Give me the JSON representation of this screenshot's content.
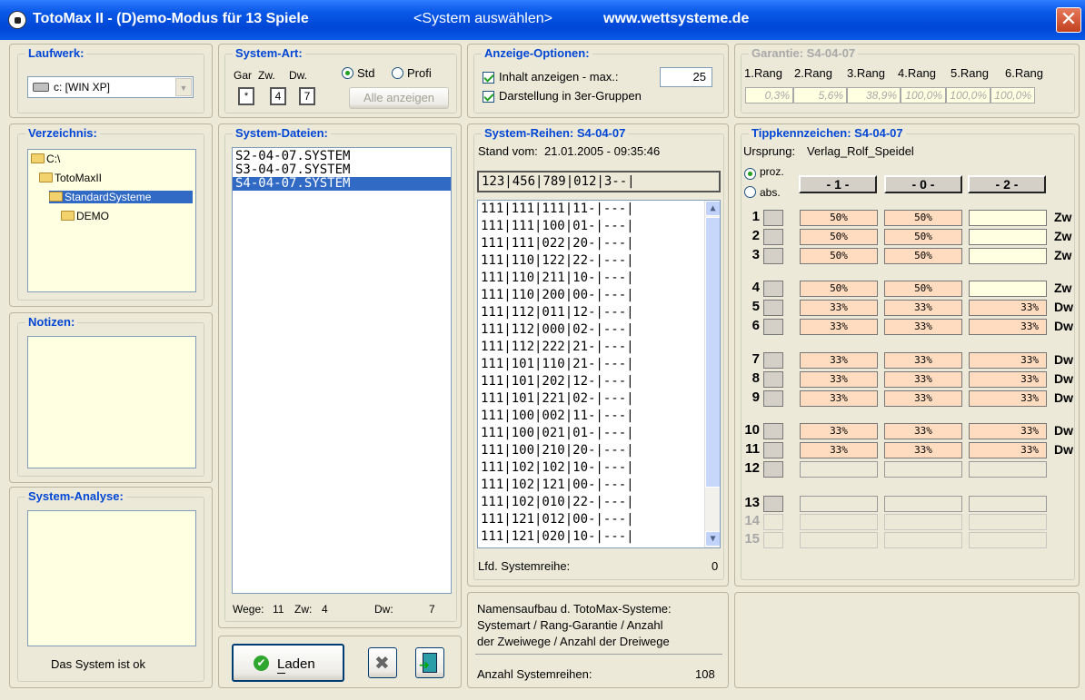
{
  "title": {
    "app": "TotoMax II - (D)emo-Modus für 13 Spiele",
    "context": "<System auswählen>",
    "url": "www.wettsysteme.de",
    "close": "✕"
  },
  "laufwerk": {
    "legend": "Laufwerk:",
    "selected": "c: [WIN XP]"
  },
  "verzeichnis": {
    "legend": "Verzeichnis:",
    "items": [
      "C:\\",
      "TotoMaxII",
      "StandardSysteme",
      "DEMO"
    ]
  },
  "notizen": {
    "legend": "Notizen:"
  },
  "analyse": {
    "legend": "System-Analyse:",
    "status": "Das System ist ok"
  },
  "system_art": {
    "legend": "System-Art:",
    "col_gar": "Gar",
    "col_zw": "Zw.",
    "col_dw": "Dw.",
    "val_gar": "*",
    "val_zw": "4",
    "val_dw": "7",
    "opt_std": "Std",
    "opt_profi": "Profi",
    "alle_btn": "Alle anzeigen"
  },
  "system_dateien": {
    "legend": "System-Dateien:",
    "files": [
      "S2-04-07.SYSTEM",
      "S3-04-07.SYSTEM",
      "S4-04-07.SYSTEM"
    ],
    "wege_label": "Wege:",
    "wege": "11",
    "zw_label": "Zw:",
    "zw": "4",
    "dw_label": "Dw:",
    "dw": "7"
  },
  "actions": {
    "laden": "Laden"
  },
  "anzeige": {
    "legend": "Anzeige-Optionen:",
    "inhalt": "Inhalt anzeigen - max.:",
    "max": "25",
    "gruppen": "Darstellung in 3er-Gruppen"
  },
  "system_reihen": {
    "legend": "System-Reihen: S4-04-07",
    "stand_label": "Stand vom:",
    "stand": "21.01.2005  -  09:35:46",
    "header": "123|456|789|012|3--|",
    "rows": [
      "111|111|111|11-|---|",
      "111|111|100|01-|---|",
      "111|111|022|20-|---|",
      "111|110|122|22-|---|",
      "111|110|211|10-|---|",
      "111|110|200|00-|---|",
      "111|112|011|12-|---|",
      "111|112|000|02-|---|",
      "111|112|222|21-|---|",
      "111|101|110|21-|---|",
      "111|101|202|12-|---|",
      "111|101|221|02-|---|",
      "111|100|002|11-|---|",
      "111|100|021|01-|---|",
      "111|100|210|20-|---|",
      "111|102|102|10-|---|",
      "111|102|121|00-|---|",
      "111|102|010|22-|---|",
      "111|121|012|00-|---|",
      "111|121|020|10-|---|"
    ],
    "lfd_label": "Lfd. Systemreihe:",
    "lfd": "0"
  },
  "info": {
    "line1": "Namensaufbau d. TotoMax-Systeme:",
    "line2": "Systemart / Rang-Garantie / Anzahl",
    "line3": "der Zweiwege / Anzahl der Dreiwege",
    "anzahl_label": "Anzahl Systemreihen:",
    "anzahl": "108"
  },
  "garantie": {
    "legend": "Garantie: S4-04-07",
    "ranks": [
      "1.Rang",
      "2.Rang",
      "3.Rang",
      "4.Rang",
      "5.Rang",
      "6.Rang"
    ],
    "values": [
      "0,3%",
      "5,6%",
      "38,9%",
      "100,0%",
      "100,0%",
      "100,0%"
    ]
  },
  "tipp": {
    "legend": "Tippkennzeichen: S4-04-07",
    "ursprung_label": "Ursprung:",
    "ursprung": "Verlag_Rolf_Speidel",
    "opt_proz": "proz.",
    "opt_abs": "abs.",
    "col1": "- 1 -",
    "col0": "- 0 -",
    "col2": "- 2 -",
    "rows": [
      {
        "n": "1",
        "a": "50%",
        "b": "50%",
        "c": "",
        "t": "Zw"
      },
      {
        "n": "2",
        "a": "50%",
        "b": "50%",
        "c": "",
        "t": "Zw"
      },
      {
        "n": "3",
        "a": "50%",
        "b": "50%",
        "c": "",
        "t": "Zw"
      },
      {
        "n": "4",
        "a": "50%",
        "b": "50%",
        "c": "",
        "t": "Zw"
      },
      {
        "n": "5",
        "a": "33%",
        "b": "33%",
        "c": "33%",
        "t": "Dw"
      },
      {
        "n": "6",
        "a": "33%",
        "b": "33%",
        "c": "33%",
        "t": "Dw"
      },
      {
        "n": "7",
        "a": "33%",
        "b": "33%",
        "c": "33%",
        "t": "Dw"
      },
      {
        "n": "8",
        "a": "33%",
        "b": "33%",
        "c": "33%",
        "t": "Dw"
      },
      {
        "n": "9",
        "a": "33%",
        "b": "33%",
        "c": "33%",
        "t": "Dw"
      },
      {
        "n": "10",
        "a": "33%",
        "b": "33%",
        "c": "33%",
        "t": "Dw"
      },
      {
        "n": "11",
        "a": "33%",
        "b": "33%",
        "c": "33%",
        "t": "Dw"
      },
      {
        "n": "12",
        "a": "",
        "b": "",
        "c": "",
        "t": ""
      },
      {
        "n": "13",
        "a": "",
        "b": "",
        "c": "",
        "t": ""
      },
      {
        "n": "14",
        "a": "",
        "b": "",
        "c": "",
        "t": ""
      },
      {
        "n": "15",
        "a": "",
        "b": "",
        "c": "",
        "t": ""
      }
    ]
  }
}
